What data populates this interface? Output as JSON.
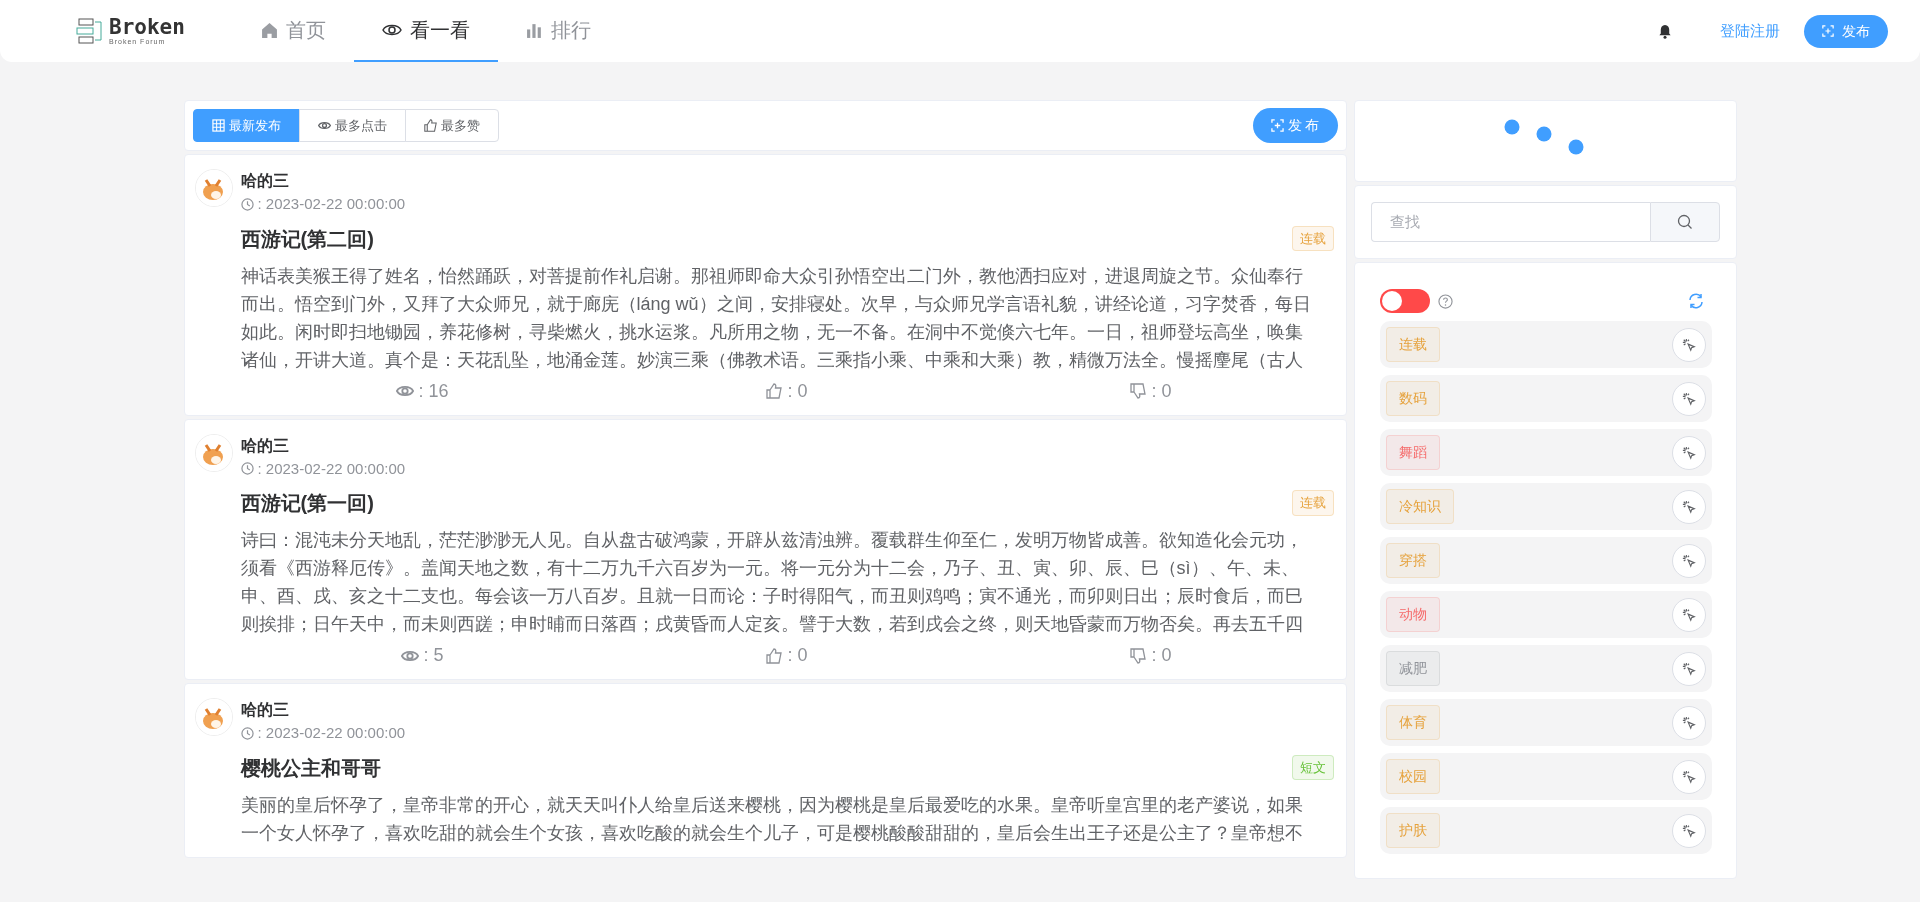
{
  "header": {
    "logo_title": "Broken",
    "logo_subtitle": "Broken Forum",
    "nav": [
      {
        "label": "首页",
        "selected": false
      },
      {
        "label": "看一看",
        "selected": true
      },
      {
        "label": "排行",
        "selected": false
      }
    ],
    "login_link": "登陆注册",
    "publish_button": "发布"
  },
  "sort_tabs": [
    {
      "label": "最新发布",
      "selected": true
    },
    {
      "label": "最多点击",
      "selected": false
    },
    {
      "label": "最多赞",
      "selected": false
    }
  ],
  "publish_button": "发 布",
  "posts": [
    {
      "author": "哈的三",
      "date": ": 2023-02-22 00:00:00",
      "title": "西游记(第二回)",
      "tag": {
        "label": "连载",
        "color": "#e6a23c"
      },
      "body": "神话表美猴王得了姓名，怡然踊跃，对菩提前作礼启谢。那祖师即命大众引孙悟空出二门外，教他洒扫应对，进退周旋之节。众仙奉行而出。悟空到门外，又拜了大众师兄，就于廊庑（láng wǔ）之间，安排寝处。次早，与众师兄学言语礼貌，讲经论道，习字焚香，每日如此。闲时即扫地锄园，养花修树，寻柴燃火，挑水运浆。凡所用之物，无一不备。在洞中不觉倏六七年。一日，祖师登坛高坐，唤集诸仙，开讲大道。真个是：天花乱坠，地涌金莲。妙演三乘（佛教术语。三乘指小乘、中乘和大乘）教，精微万法全。慢摇麈尾（古人",
      "views": ": 16",
      "likes": ": 0",
      "dislikes": ": 0"
    },
    {
      "author": "哈的三",
      "date": ": 2023-02-22 00:00:00",
      "title": "西游记(第一回)",
      "tag": {
        "label": "连载",
        "color": "#e6a23c"
      },
      "body": "诗曰：混沌未分天地乱，茫茫渺渺无人见。自从盘古破鸿蒙，开辟从兹清浊辨。覆载群生仰至仁，发明万物皆成善。欲知造化会元功，须看《西游释厄传》。盖闻天地之数，有十二万九千六百岁为一元。将一元分为十二会，乃子、丑、寅、卯、辰、巳（sì）、午、未、申、酉、戌、亥之十二支也。每会该一万八百岁。且就一日而论：子时得阳气，而丑则鸡鸣；寅不通光，而卯则日出；辰时食后，而巳则挨排；日午天中，而未则西蹉；申时晡而日落酉；戌黄昏而人定亥。譬于大数，若到戌会之终，则天地昏蒙而万物否矣。再去五千四",
      "views": ": 5",
      "likes": ": 0",
      "dislikes": ": 0"
    },
    {
      "author": "哈的三",
      "date": ": 2023-02-22 00:00:00",
      "title": "樱桃公主和哥哥",
      "tag": {
        "label": "短文",
        "color": "#67c23a"
      },
      "body": "美丽的皇后怀孕了，皇帝非常的开心，就天天叫仆人给皇后送来樱桃，因为樱桃是皇后最爱吃的水果。皇帝听皇宫里的老产婆说，如果一个女人怀孕了，喜欢吃甜的就会生个女孩，喜欢吃酸的就会生个儿子，可是樱桃酸酸甜甜的，皇后会生出王子还是公主了？皇帝想不"
    }
  ],
  "search": {
    "placeholder": "查找"
  },
  "filter_switch": {
    "on": false
  },
  "categories": [
    {
      "label": "连载",
      "color": "#e6a23c"
    },
    {
      "label": "数码",
      "color": "#e6a23c"
    },
    {
      "label": "舞蹈",
      "color": "#f56c6c"
    },
    {
      "label": "冷知识",
      "color": "#e6a23c"
    },
    {
      "label": "穿搭",
      "color": "#e6a23c"
    },
    {
      "label": "动物",
      "color": "#f56c6c"
    },
    {
      "label": "减肥",
      "color": "#909399"
    },
    {
      "label": "体育",
      "color": "#e6a23c"
    },
    {
      "label": "校园",
      "color": "#e6a23c"
    },
    {
      "label": "护肤",
      "color": "#e6a23c"
    }
  ]
}
